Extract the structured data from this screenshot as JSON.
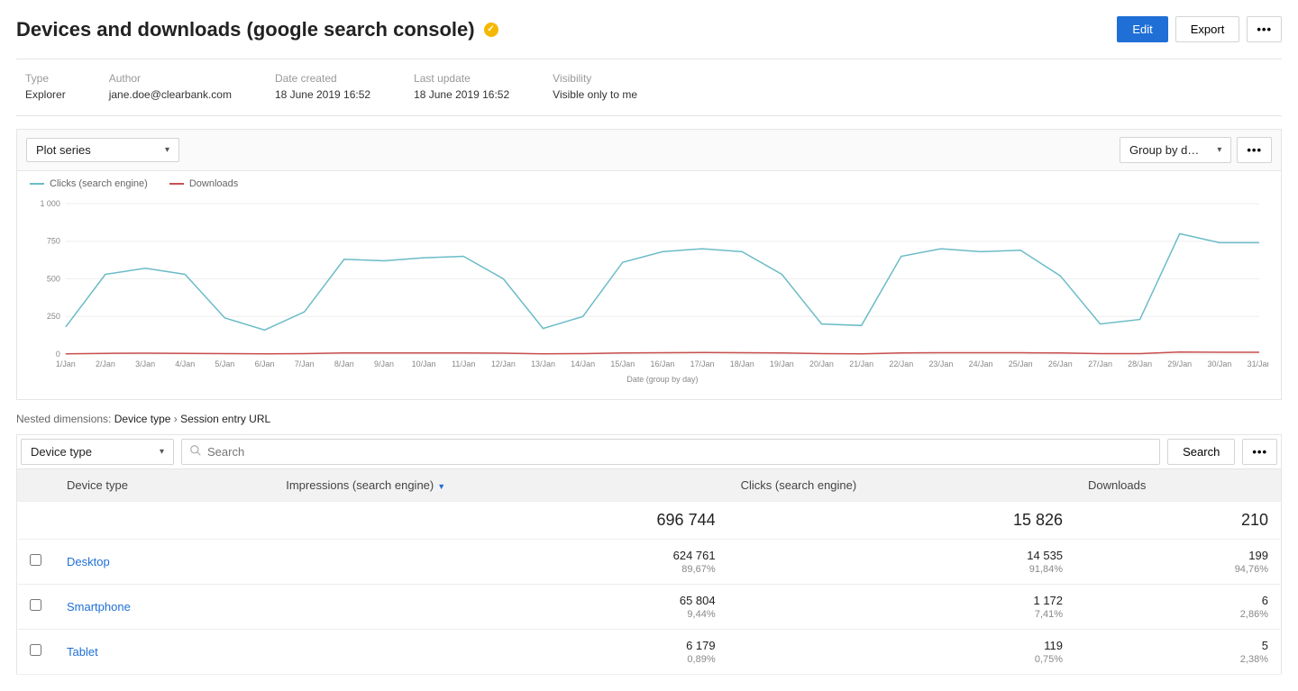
{
  "header": {
    "title": "Devices and downloads (google search console)",
    "edit": "Edit",
    "export": "Export"
  },
  "meta": {
    "type_label": "Type",
    "type_value": "Explorer",
    "author_label": "Author",
    "author_value": "jane.doe@clearbank.com",
    "created_label": "Date created",
    "created_value": "18 June 2019 16:52",
    "updated_label": "Last update",
    "updated_value": "18 June 2019 16:52",
    "visibility_label": "Visibility",
    "visibility_value": "Visible only to me"
  },
  "chart_controls": {
    "plot_series": "Plot series",
    "group_by": "Group by d…"
  },
  "legend": {
    "clicks": "Clicks (search engine)",
    "downloads": "Downloads"
  },
  "nested": {
    "prefix": "Nested dimensions: ",
    "dim1": "Device type",
    "sep": " › ",
    "dim2": "Session entry URL"
  },
  "filters": {
    "device_type": "Device type",
    "search_placeholder": "Search",
    "search_btn": "Search"
  },
  "table": {
    "cols": {
      "device": "Device type",
      "impressions": "Impressions (search engine)",
      "clicks": "Clicks (search engine)",
      "downloads": "Downloads"
    },
    "total": {
      "impressions": "696 744",
      "clicks": "15 826",
      "downloads": "210"
    },
    "rows": [
      {
        "name": "Desktop",
        "impressions": "624 761",
        "impressions_pct": "89,67%",
        "clicks": "14 535",
        "clicks_pct": "91,84%",
        "downloads": "199",
        "downloads_pct": "94,76%"
      },
      {
        "name": "Smartphone",
        "impressions": "65 804",
        "impressions_pct": "9,44%",
        "clicks": "1 172",
        "clicks_pct": "7,41%",
        "downloads": "6",
        "downloads_pct": "2,86%"
      },
      {
        "name": "Tablet",
        "impressions": "6 179",
        "impressions_pct": "0,89%",
        "clicks": "119",
        "clicks_pct": "0,75%",
        "downloads": "5",
        "downloads_pct": "2,38%"
      }
    ]
  },
  "chart_data": {
    "type": "line",
    "xlabel": "Date (group by day)",
    "ylabel": "",
    "ylim": [
      0,
      1000
    ],
    "yticks": [
      0,
      250,
      500,
      750,
      1000
    ],
    "categories": [
      "1/Jan",
      "2/Jan",
      "3/Jan",
      "4/Jan",
      "5/Jan",
      "6/Jan",
      "7/Jan",
      "8/Jan",
      "9/Jan",
      "10/Jan",
      "11/Jan",
      "12/Jan",
      "13/Jan",
      "14/Jan",
      "15/Jan",
      "16/Jan",
      "17/Jan",
      "18/Jan",
      "19/Jan",
      "20/Jan",
      "21/Jan",
      "22/Jan",
      "23/Jan",
      "24/Jan",
      "25/Jan",
      "26/Jan",
      "27/Jan",
      "28/Jan",
      "29/Jan",
      "30/Jan",
      "31/Jan"
    ],
    "series": [
      {
        "name": "Clicks (search engine)",
        "color": "#6bbcc7",
        "values": [
          180,
          530,
          570,
          530,
          240,
          160,
          280,
          630,
          620,
          640,
          650,
          500,
          170,
          250,
          610,
          680,
          700,
          680,
          530,
          200,
          190,
          650,
          700,
          680,
          690,
          520,
          200,
          230,
          800,
          740,
          740
        ]
      },
      {
        "name": "Downloads",
        "color": "#c94f4f",
        "values": [
          2,
          5,
          6,
          5,
          3,
          2,
          3,
          7,
          7,
          8,
          8,
          6,
          2,
          3,
          8,
          9,
          10,
          9,
          7,
          3,
          2,
          8,
          9,
          9,
          9,
          7,
          3,
          3,
          14,
          12,
          12
        ]
      }
    ]
  }
}
